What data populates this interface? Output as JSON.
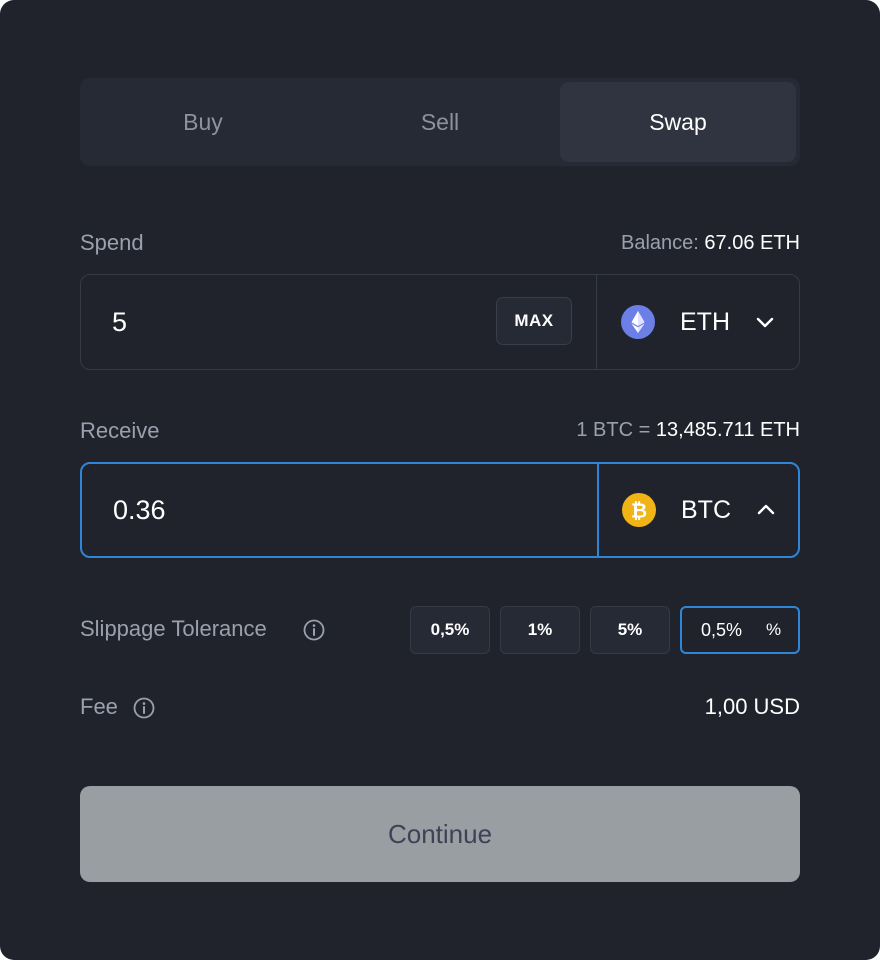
{
  "tabs": {
    "buy": "Buy",
    "sell": "Sell",
    "swap": "Swap",
    "active": "Swap"
  },
  "spend": {
    "label": "Spend",
    "balance_label": "Balance:",
    "balance_value": "67.06 ETH",
    "amount": "5",
    "max_label": "MAX",
    "token": "ETH",
    "token_icon": "ethereum-icon",
    "dropdown_icon": "chevron-down-icon"
  },
  "receive": {
    "label": "Receive",
    "rate_label": "1 BTC =",
    "rate_value": "13,485.711 ETH",
    "amount": "0.36",
    "token": "BTC",
    "token_icon": "bitcoin-icon",
    "dropdown_icon": "chevron-up-icon"
  },
  "slippage": {
    "label": "Slippage Tolerance",
    "options": [
      "0,5%",
      "1%",
      "5%"
    ],
    "custom_value": "0,5%",
    "custom_suffix": "%"
  },
  "fee": {
    "label": "Fee",
    "value": "1,00 USD"
  },
  "continue_label": "Continue",
  "colors": {
    "background": "#20232c",
    "accent": "#2f86d6",
    "eth": "#6c7fe6",
    "btc": "#f0b417",
    "button_disabled": "#989ea1"
  }
}
